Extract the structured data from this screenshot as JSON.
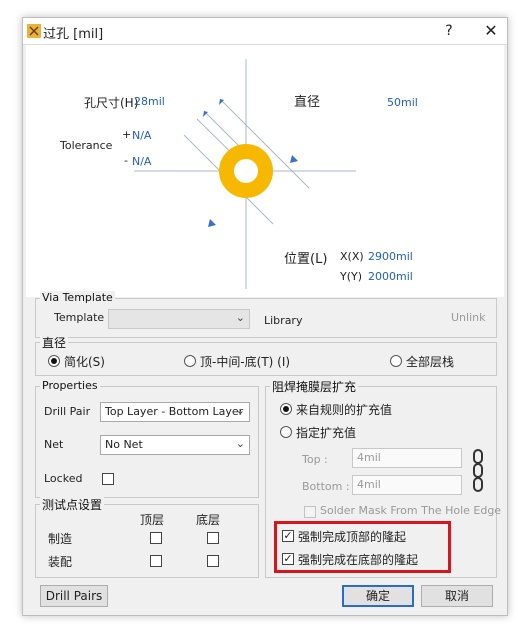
{
  "window": {
    "title": "过孔 [mil]",
    "help_label": "?",
    "close_label": "✕"
  },
  "diagram": {
    "hole_size_label": "孔尺寸(H)",
    "hole_size_value": "28mil",
    "tolerance_label": "Tolerance",
    "tol_plus_sign": "+",
    "tol_plus_value": "N/A",
    "tol_minus_sign": "-",
    "tol_minus_value": "N/A",
    "diameter_label": "直径",
    "diameter_value": "50mil",
    "location_label": "位置(L)",
    "x_label": "X(X)",
    "x_value": "2900mil",
    "y_label": "Y(Y)",
    "y_value": "2000mil",
    "colors": {
      "pad": "#f6b800",
      "line": "#aab7c9",
      "arrow": "#3a6fd0"
    }
  },
  "via_template": {
    "group_title": "Via Template",
    "template_label": "Template",
    "template_value": "",
    "library_label": "Library",
    "unlink_label": "Unlink"
  },
  "diameter_group": {
    "title": "直径",
    "options": [
      "简化(S)",
      "顶-中间-底(T) (I)",
      "全部层栈"
    ],
    "selected": "简化(S)"
  },
  "properties": {
    "title": "Properties",
    "drill_pair_label": "Drill Pair",
    "drill_pair_value": "Top Layer - Bottom Layer",
    "net_label": "Net",
    "net_value": "No Net",
    "locked_label": "Locked"
  },
  "solder_mask": {
    "title": "阻焊掩膜层扩充",
    "option_rule": "来自规则的扩充值",
    "option_manual": "指定扩充值",
    "top_label": "Top :",
    "top_value": "4mil",
    "bottom_label": "Bottom :",
    "bottom_value": "4mil",
    "from_hole_edge_label": "Solder Mask From The Hole Edge",
    "force_top_label": "强制完成顶部的隆起",
    "force_bottom_label": "强制完成在底部的隆起",
    "force_top_checked": true,
    "force_bottom_checked": true
  },
  "testpoint": {
    "title": "测试点设置",
    "col_top": "顶层",
    "col_bottom": "底层",
    "row_fab": "制造",
    "row_assy": "装配"
  },
  "footer": {
    "drill_pairs_label": "Drill Pairs",
    "ok_label": "确定",
    "cancel_label": "取消"
  }
}
